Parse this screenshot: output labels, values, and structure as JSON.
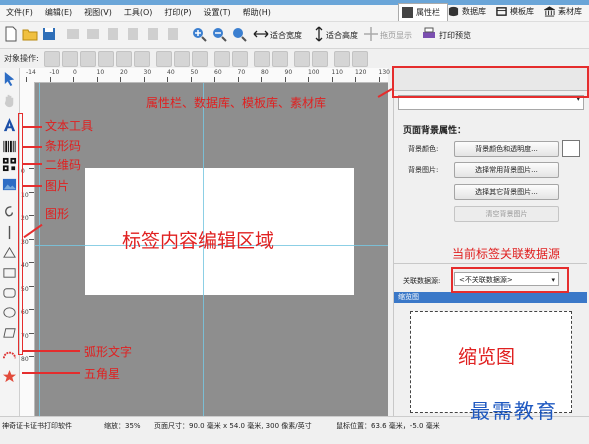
{
  "app": {
    "title_strip": ""
  },
  "menu": [
    "文件(F)",
    "编辑(E)",
    "视图(V)",
    "工具(O)",
    "打印(P)",
    "设置(T)",
    "帮助(H)"
  ],
  "toolbar": {
    "fit_width": "适合宽度",
    "fit_height": "适合高度",
    "drag_display": "拖页显示",
    "print_preview": "打印预览"
  },
  "objbar": {
    "label": "对象操作:"
  },
  "ruler": {
    "h_numbers": [
      "-14",
      "-10",
      "0",
      "10",
      "20",
      "30",
      "40",
      "50",
      "60",
      "70",
      "80",
      "90",
      "100",
      "110",
      "120",
      "130"
    ],
    "v_numbers": [
      "0",
      "10",
      "20",
      "30",
      "40",
      "50",
      "60",
      "70",
      "80"
    ]
  },
  "right_panel": {
    "tabs": [
      "属性栏",
      "数据库",
      "模板库",
      "素材库"
    ],
    "page_bg_title": "页面背景属性：",
    "bg_color_label": "背景颜色:",
    "bg_color_btn": "背景颜色和透明度...",
    "bg_image_label": "背景图片:",
    "common_bg_btn": "选择常用背景图片...",
    "other_bg_btn": "选择其它背景图片...",
    "clear_bg_btn": "清空背景图片",
    "datasource_label": "关联数据源:",
    "datasource_value": "<不关联数据源>",
    "thumb_header": "缩览图"
  },
  "status": {
    "app": "神奇证卡证书打印软件",
    "zoom": "缩放：35%",
    "page_size": "页面尺寸：90.0 毫米 x 54.0 毫米, 300 像素/英寸",
    "mouse": "鼠标位置：63.6 毫米，-5.0 毫米"
  },
  "annotations": {
    "panels": "属性栏、数据库、模板库、素材库",
    "text_tool": "文本工具",
    "barcode": "条形码",
    "qrcode": "二维码",
    "image": "图片",
    "shape": "图形",
    "edit_area": "标签内容编辑区域",
    "datasource": "当前标签关联数据源",
    "thumbnail": "缩览图",
    "arc_text": "弧形文字",
    "star": "五角星",
    "watermark": "最需教育"
  },
  "colors": {
    "accent_red": "#e52d2d",
    "canvas_gray": "#8e8e8e",
    "guide_cyan": "#78c7e0"
  }
}
